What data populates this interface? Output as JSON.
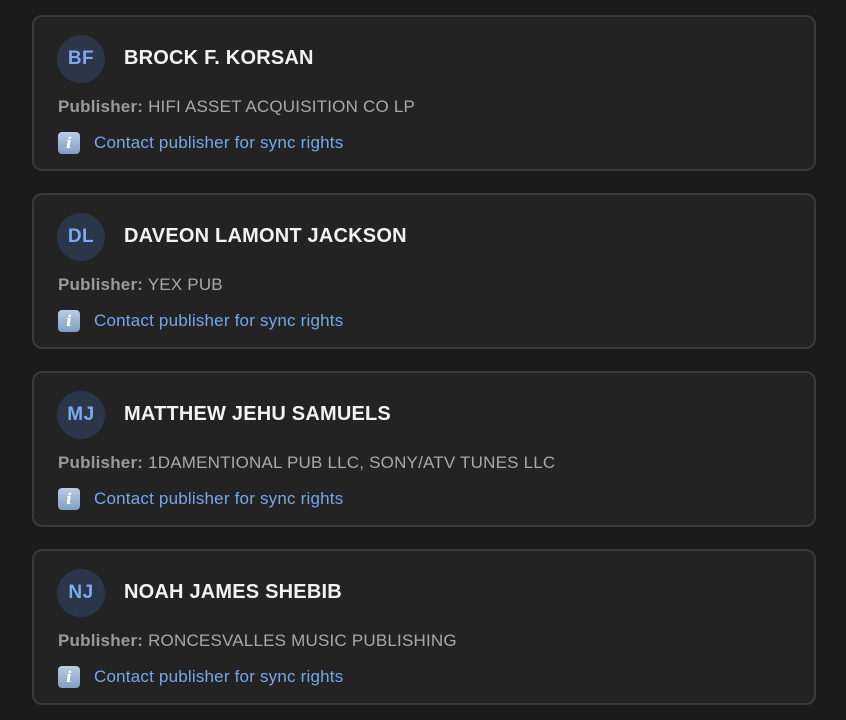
{
  "publisher_label": "Publisher:",
  "contact_label": "Contact publisher for sync rights",
  "info_icon_glyph": "i",
  "colors": {
    "background": "#1b1b1b",
    "card": "#232323",
    "avatar_bg": "#2b3648",
    "accent": "#74a7ec"
  },
  "writers": [
    {
      "initials": "BF",
      "name": "BROCK F. KORSAN",
      "publisher": "HIFI ASSET ACQUISITION CO LP"
    },
    {
      "initials": "DL",
      "name": "DAVEON LAMONT JACKSON",
      "publisher": "YEX PUB"
    },
    {
      "initials": "MJ",
      "name": "MATTHEW JEHU SAMUELS",
      "publisher": "1DAMENTIONAL PUB LLC, SONY/ATV TUNES LLC"
    },
    {
      "initials": "NJ",
      "name": "NOAH JAMES SHEBIB",
      "publisher": "RONCESVALLES MUSIC PUBLISHING"
    }
  ]
}
